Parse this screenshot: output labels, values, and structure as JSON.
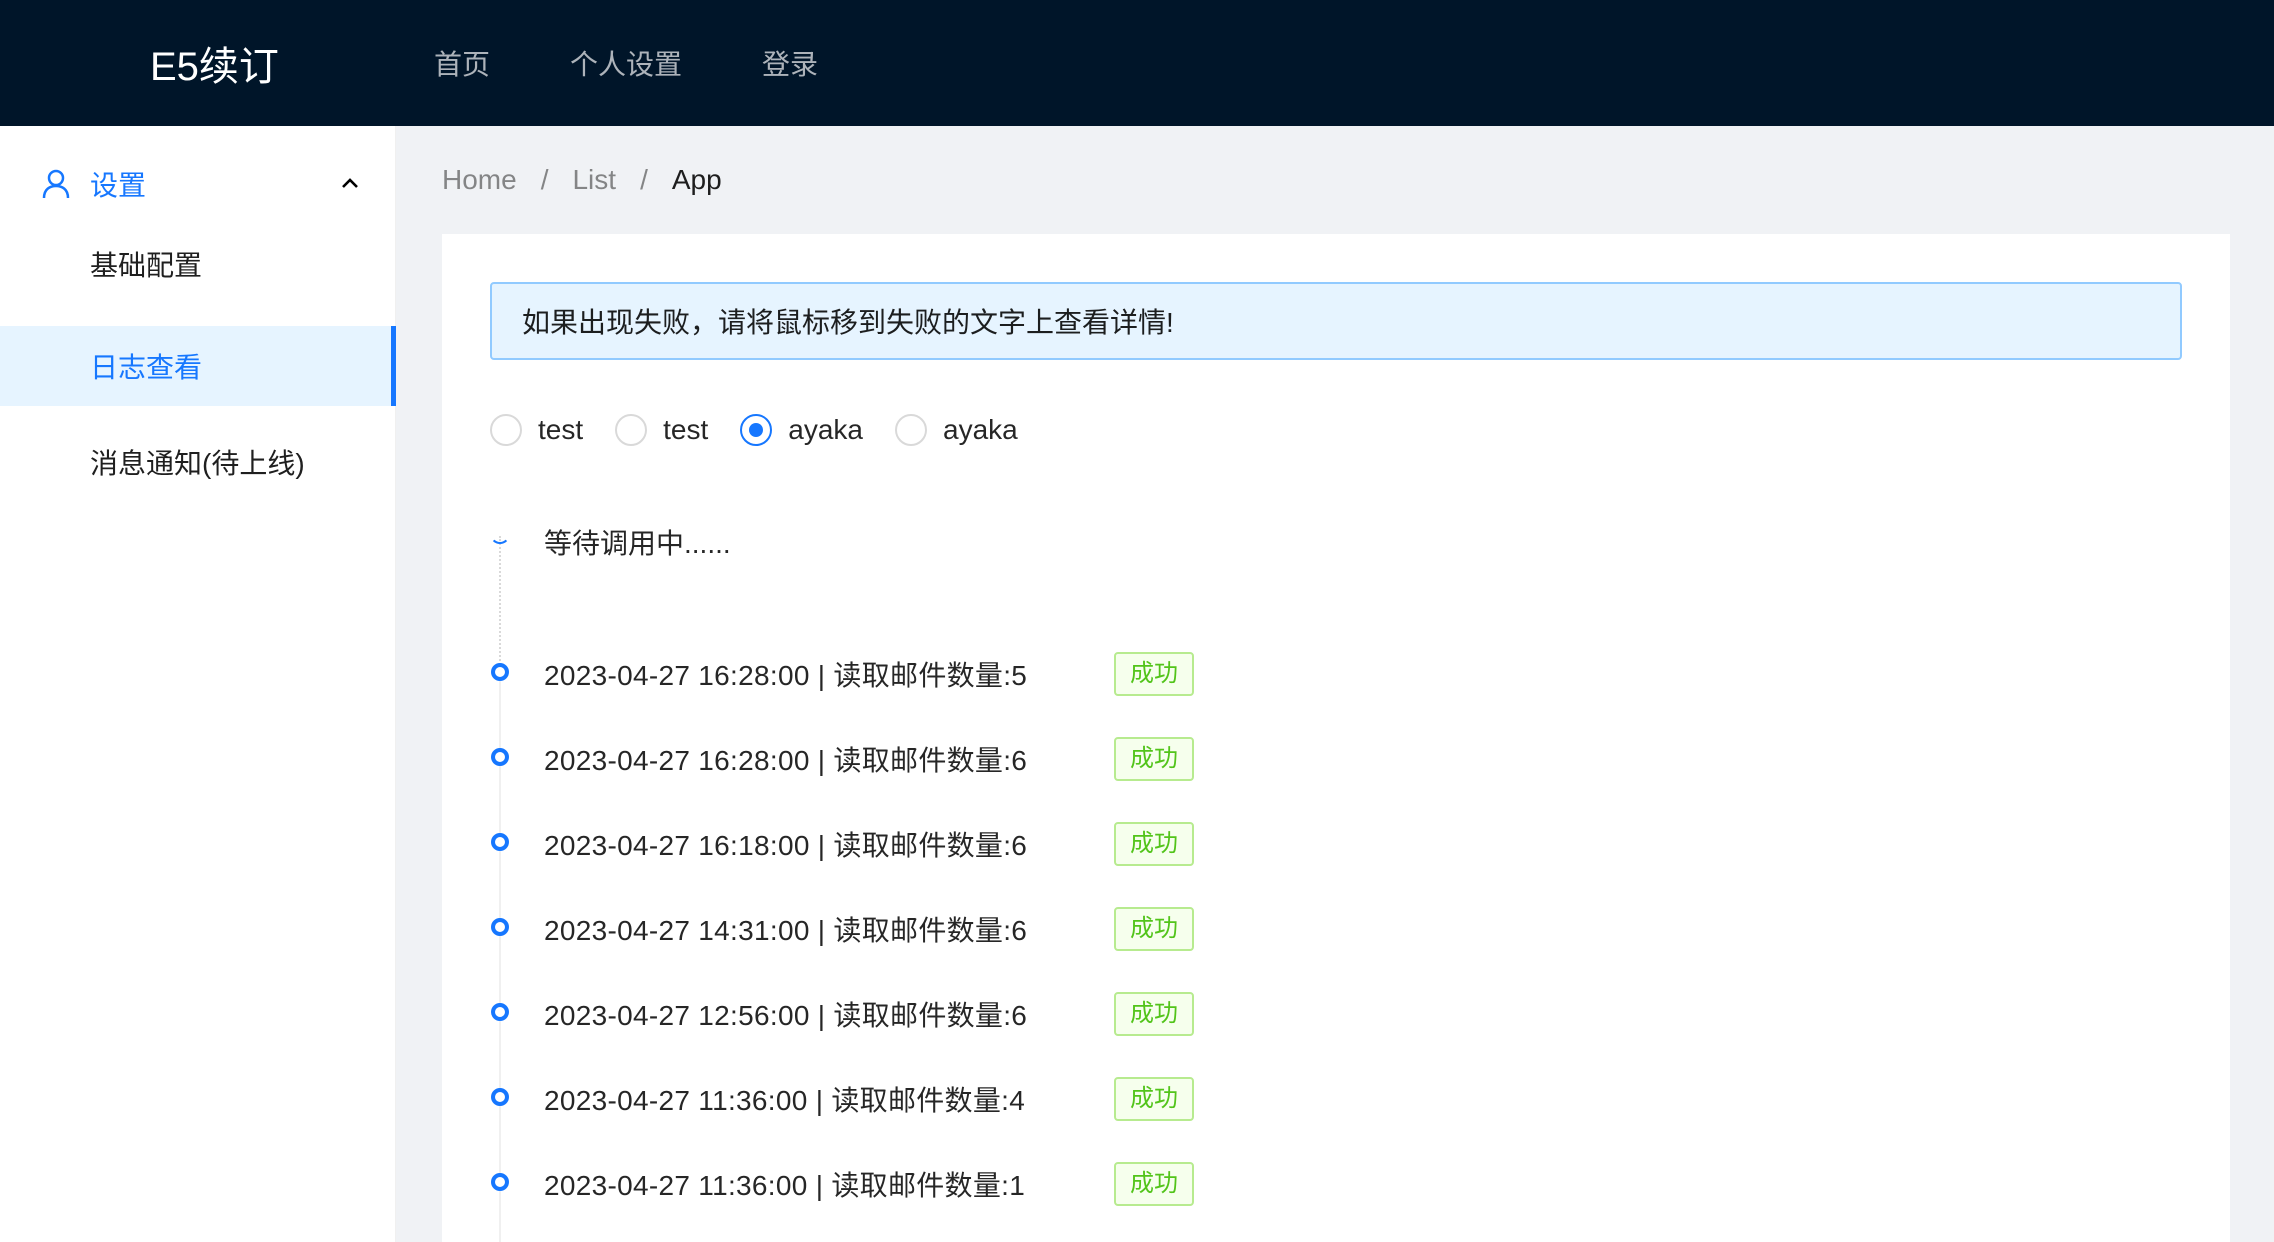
{
  "header": {
    "logo": "E5续订",
    "nav": [
      "首页",
      "个人设置",
      "登录"
    ]
  },
  "sidebar": {
    "group_title": "设置",
    "items": [
      {
        "label": "基础配置",
        "selected": false
      },
      {
        "label": "日志查看",
        "selected": true
      },
      {
        "label": "消息通知(待上线)",
        "selected": false
      }
    ]
  },
  "breadcrumb": {
    "items": [
      "Home",
      "List",
      "App"
    ],
    "separator": "/"
  },
  "alert": {
    "text": "如果出现失败，请将鼠标移到失败的文字上查看详情!"
  },
  "radios": {
    "options": [
      {
        "label": "test",
        "checked": false
      },
      {
        "label": "test",
        "checked": false
      },
      {
        "label": "ayaka",
        "checked": true
      },
      {
        "label": "ayaka",
        "checked": false
      }
    ]
  },
  "timeline": {
    "pending_text": "等待调用中......",
    "entries": [
      {
        "text": "2023-04-27 16:28:00 |  读取邮件数量:5",
        "status": "成功"
      },
      {
        "text": "2023-04-27 16:28:00 |  读取邮件数量:6",
        "status": "成功"
      },
      {
        "text": "2023-04-27 16:18:00 |  读取邮件数量:6",
        "status": "成功"
      },
      {
        "text": "2023-04-27 14:31:00 |  读取邮件数量:6",
        "status": "成功"
      },
      {
        "text": "2023-04-27 12:56:00 |  读取邮件数量:6",
        "status": "成功"
      },
      {
        "text": "2023-04-27 11:36:00 |  读取邮件数量:4",
        "status": "成功"
      },
      {
        "text": "2023-04-27 11:36:00 |  读取邮件数量:1",
        "status": "成功"
      }
    ]
  },
  "colors": {
    "header_bg": "#001529",
    "primary": "#1677ff",
    "success": "#52c41a",
    "alert_bg": "#e6f4ff"
  }
}
